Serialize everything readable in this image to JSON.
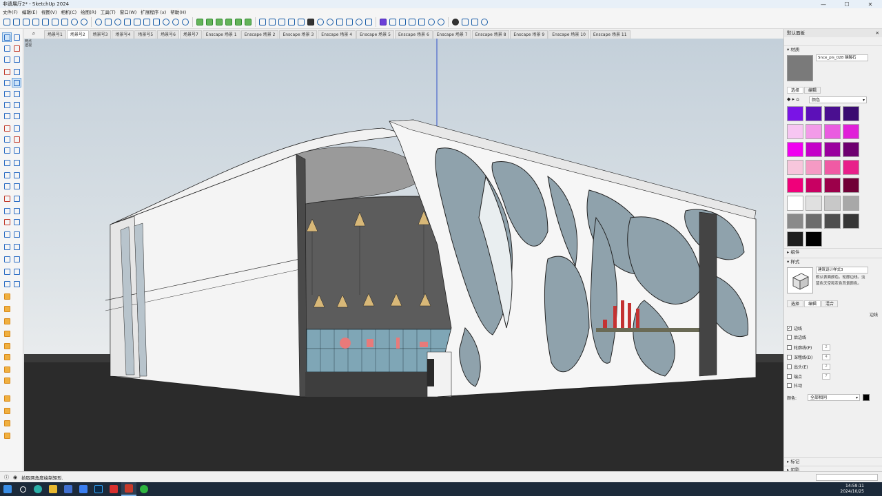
{
  "window": {
    "title": "非遗展厅2* - SketchUp 2024"
  },
  "menu": [
    "文件(F)",
    "编辑(E)",
    "视图(V)",
    "相机(C)",
    "绘图(R)",
    "工具(T)",
    "窗口(W)",
    "扩展程序 (x)",
    "帮助(H)"
  ],
  "scene_tabs": [
    "场景号1",
    "场景号2",
    "场景号3",
    "场景号4",
    "场景号5",
    "场景号6",
    "场景号7",
    "Enscape 场景 1",
    "Enscape 场景 2",
    "Enscape 场景 3",
    "Enscape 场景 4",
    "Enscape 场景 5",
    "Enscape 场景 6",
    "Enscape 场景 7",
    "Enscape 场景 8",
    "Enscape 场景 9",
    "Enscape 场景 10",
    "Enscape 场景 11"
  ],
  "active_tab_index": 1,
  "camera_label": "两点透视",
  "tray": {
    "title": "默认面板",
    "materials": {
      "header": "材质",
      "name": "Snce_pls_028 磷酸石",
      "tabs": [
        "选择",
        "编辑"
      ],
      "category": "颜色",
      "swatches": [
        "#7a14e6",
        "#5c10b8",
        "#4a0f90",
        "#3a0c70",
        "#f7c6f2",
        "#f29be8",
        "#ea5ce0",
        "#e020d8",
        "#f000f0",
        "#c400c8",
        "#9a009e",
        "#6e0070",
        "#f7c6dc",
        "#f59ac4",
        "#f05aa4",
        "#e8208a",
        "#f0007a",
        "#c80062",
        "#9c004a",
        "#700036",
        "#ffffff",
        "#e0e0e0",
        "#c8c8c8",
        "#a8a8a8",
        "#8a8a8a",
        "#6c6c6c",
        "#4e4e4e",
        "#363636",
        "#1e1e1e",
        "#000000"
      ]
    },
    "components": {
      "header": "组件"
    },
    "styles": {
      "header": "样式",
      "name": "建筑设计样式3",
      "description": "默认表面颜色。轮廓边线。淡蓝色天空和灰色背景颜色。",
      "tabs": [
        "选择",
        "编辑",
        "混合"
      ],
      "edge_label": "边线",
      "checkboxes": [
        {
          "label": "边线",
          "checked": true
        },
        {
          "label": "后边线",
          "checked": false
        },
        {
          "label": "轮廓线(P)",
          "checked": false,
          "value": "2"
        },
        {
          "label": "深粗线(D)",
          "checked": false,
          "value": "4"
        },
        {
          "label": "出头(E)",
          "checked": false,
          "value": "2"
        },
        {
          "label": "端点",
          "checked": false,
          "value": "7"
        },
        {
          "label": "抖动",
          "checked": false
        }
      ],
      "color_label": "颜色:",
      "color_value": "全部相同"
    },
    "tags": {
      "header": "标记"
    },
    "shadows": {
      "header": "阴影"
    }
  },
  "status": {
    "message": "拾取两角度绘制矩形."
  },
  "clock": {
    "time": "14:59:11",
    "date": "2024/10/25"
  },
  "colors": {
    "sky_top": "#c4d0da",
    "ground": "#2a2a2a",
    "structure": "#f5f5f5",
    "interior": "#5a5a5a"
  }
}
